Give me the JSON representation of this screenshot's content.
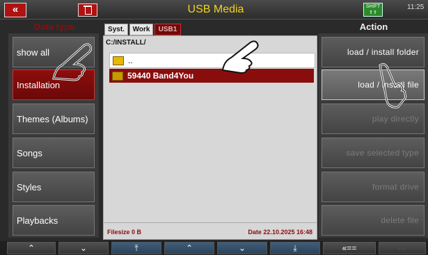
{
  "header": {
    "title": "USB Media",
    "back_icon": "«",
    "shift_label": "SHIFT",
    "time": "11:25"
  },
  "data_type": {
    "label": "Data type",
    "items": [
      "show all",
      "Installation",
      "Themes (Albums)",
      "Songs",
      "Styles",
      "Playbacks"
    ],
    "selected": "Installation"
  },
  "tabs": [
    "Syst.",
    "Work",
    "USB1"
  ],
  "active_tab": "USB1",
  "browser": {
    "path": "C:/INSTALL/",
    "parent": "..",
    "selected_file": "59440  Band4You",
    "filesize": "Filesize  0 B",
    "date": "Date  22.10.2025    16:48"
  },
  "action": {
    "label": "Action",
    "buttons": [
      "load / install folder",
      "load / install file",
      "play directly",
      "save selected type",
      "format drive",
      "delete file"
    ]
  },
  "nav": [
    "«==",
    "---"
  ],
  "colors": {
    "accent_red": "#8a0d0d",
    "title_yellow": "#f2d31a"
  }
}
